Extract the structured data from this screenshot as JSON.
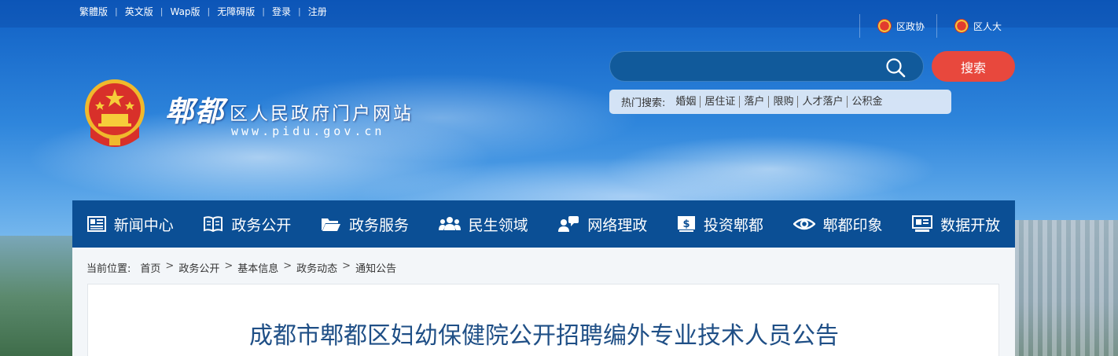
{
  "top_links": [
    "繁體版",
    "英文版",
    "Wap版",
    "无障碍版",
    "登录",
    "注册"
  ],
  "top_right": {
    "cppcc": "区政协",
    "npc": "区人大"
  },
  "search": {
    "placeholder": "",
    "button_label": "搜索"
  },
  "hot_search": {
    "label": "热门搜索:",
    "items": [
      "婚姻",
      "居住证",
      "落户",
      "限购",
      "人才落户",
      "公积金"
    ]
  },
  "site": {
    "name_big": "郫都",
    "name_rest": "区人民政府门户网站",
    "url": "www.pidu.gov.cn"
  },
  "nav": [
    {
      "label": "新闻中心",
      "icon": "newspaper-icon"
    },
    {
      "label": "政务公开",
      "icon": "book-icon"
    },
    {
      "label": "政务服务",
      "icon": "folder-icon"
    },
    {
      "label": "民生领域",
      "icon": "people-icon"
    },
    {
      "label": "网络理政",
      "icon": "chat-user-icon"
    },
    {
      "label": "投资郫都",
      "icon": "dollar-icon"
    },
    {
      "label": "郫都印象",
      "icon": "eye-icon"
    },
    {
      "label": "数据开放",
      "icon": "monitor-icon"
    }
  ],
  "breadcrumb": {
    "label": "当前位置:",
    "items": [
      "首页",
      "政务公开",
      "基本信息",
      "政务动态",
      "通知公告"
    ]
  },
  "article": {
    "title": "成都市郫都区妇幼保健院公开招聘编外专业技术人员公告"
  }
}
